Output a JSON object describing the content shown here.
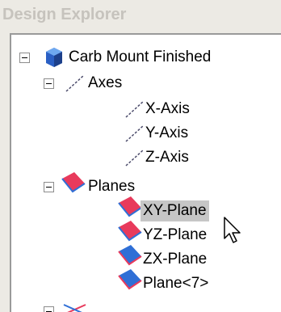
{
  "window": {
    "title": "Design Explorer"
  },
  "tree": {
    "root": {
      "label": "Carb Mount Finished",
      "icon": "part-icon"
    },
    "axes": {
      "label": "Axes",
      "icon": "axis-icon",
      "children": [
        {
          "label": "X-Axis",
          "icon": "axis-icon"
        },
        {
          "label": "Y-Axis",
          "icon": "axis-icon"
        },
        {
          "label": "Z-Axis",
          "icon": "axis-icon"
        }
      ]
    },
    "planes": {
      "label": "Planes",
      "icon": "plane-icon",
      "children": [
        {
          "label": "XY-Plane",
          "icon": "plane-icon",
          "selected": true
        },
        {
          "label": "YZ-Plane",
          "icon": "plane-icon"
        },
        {
          "label": "ZX-Plane",
          "icon": "plane-icon"
        },
        {
          "label": "Plane<7>",
          "icon": "plane-icon"
        }
      ]
    },
    "points": {
      "icon": "points-icon"
    }
  },
  "colors": {
    "panel_background": "#eceae4",
    "selection": "#c6c6c6",
    "plane_fill": "#e83a5c",
    "plane_blue": "#2f6fd6",
    "part_blue": "#2a5fc4"
  },
  "cursor": {
    "icon": "mouse-pointer-icon"
  }
}
